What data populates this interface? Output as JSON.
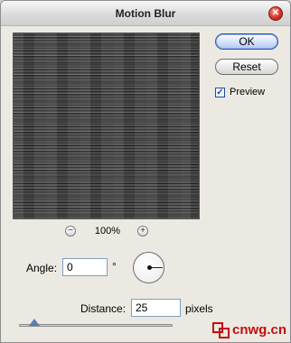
{
  "window": {
    "title": "Motion Blur",
    "close_icon": "close-icon"
  },
  "preview": {
    "zoom_level": "100%",
    "zoom_out_symbol": "−",
    "zoom_in_symbol": "+"
  },
  "buttons": {
    "ok_label": "OK",
    "reset_label": "Reset"
  },
  "preview_toggle": {
    "label": "Preview",
    "checked": true
  },
  "angle": {
    "label": "Angle:",
    "value": "0",
    "unit": "°"
  },
  "distance": {
    "label": "Distance:",
    "value": "25",
    "unit": "pixels",
    "slider_fraction": 0.1
  },
  "watermark": {
    "text": "cnwg.cn"
  },
  "colors": {
    "ok_border": "#2b55a8",
    "close_red": "#d9312a",
    "watermark_red": "#c40d0d"
  }
}
